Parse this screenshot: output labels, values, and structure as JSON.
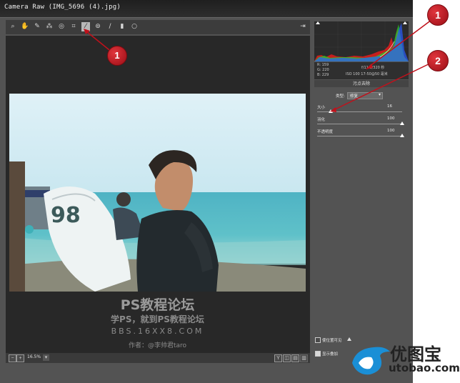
{
  "window": {
    "title": "Camera Raw (IMG_5696 (4).jpg)"
  },
  "toolbar": {
    "tools": [
      {
        "name": "zoom-tool",
        "glyph": "⌕",
        "active": false
      },
      {
        "name": "hand-tool",
        "glyph": "✋",
        "active": false
      },
      {
        "name": "white-balance-tool",
        "glyph": "✎",
        "active": false
      },
      {
        "name": "color-sampler-tool",
        "glyph": "⁂",
        "active": false
      },
      {
        "name": "targeted-adjustment-tool",
        "glyph": "◎",
        "active": false
      },
      {
        "name": "crop-tool",
        "glyph": "⌗",
        "active": false
      },
      {
        "name": "spot-removal-tool",
        "glyph": "⁄",
        "active": true
      },
      {
        "name": "red-eye-tool",
        "glyph": "⊚",
        "active": false
      },
      {
        "name": "adjustment-brush-tool",
        "glyph": "∕",
        "active": false
      },
      {
        "name": "graduated-filter-tool",
        "glyph": "▮",
        "active": false
      },
      {
        "name": "radial-filter-tool",
        "glyph": "○",
        "active": false
      }
    ],
    "open_preferences_glyph": "⇥"
  },
  "histogram": {
    "colors": {
      "red": "#e21c1c",
      "green": "#28d028",
      "blue": "#2a5cff"
    }
  },
  "info": {
    "r": "R: 159",
    "g": "G: 220",
    "b": "B: 229",
    "line1": "f/11   1/320 秒",
    "line2": "ISO 100   17-50@50 毫米"
  },
  "panel": {
    "title": "污点去除",
    "type_label": "类型:",
    "type_value": "修复",
    "size_label": "大小",
    "size_value": "16",
    "feather_label": "羽化",
    "feather_value": "100",
    "opacity_label": "不透明度",
    "opacity_value": "100",
    "visualize_label": "使位置可见",
    "overlay_label": "显示叠加"
  },
  "zoom": {
    "value": "16.5%"
  },
  "watermark": {
    "line1": "PS教程论坛",
    "line2": "学PS，就到PS教程论坛",
    "line3": "BBS.16XX8.COM",
    "line4": "作者：@李帅君taro"
  },
  "annotations": {
    "marker1": "1",
    "marker2": "2"
  },
  "logo": {
    "cn": "优图宝",
    "en": "utobao.com"
  },
  "bottom_buttons": [
    "Y",
    "◫",
    "▤"
  ]
}
